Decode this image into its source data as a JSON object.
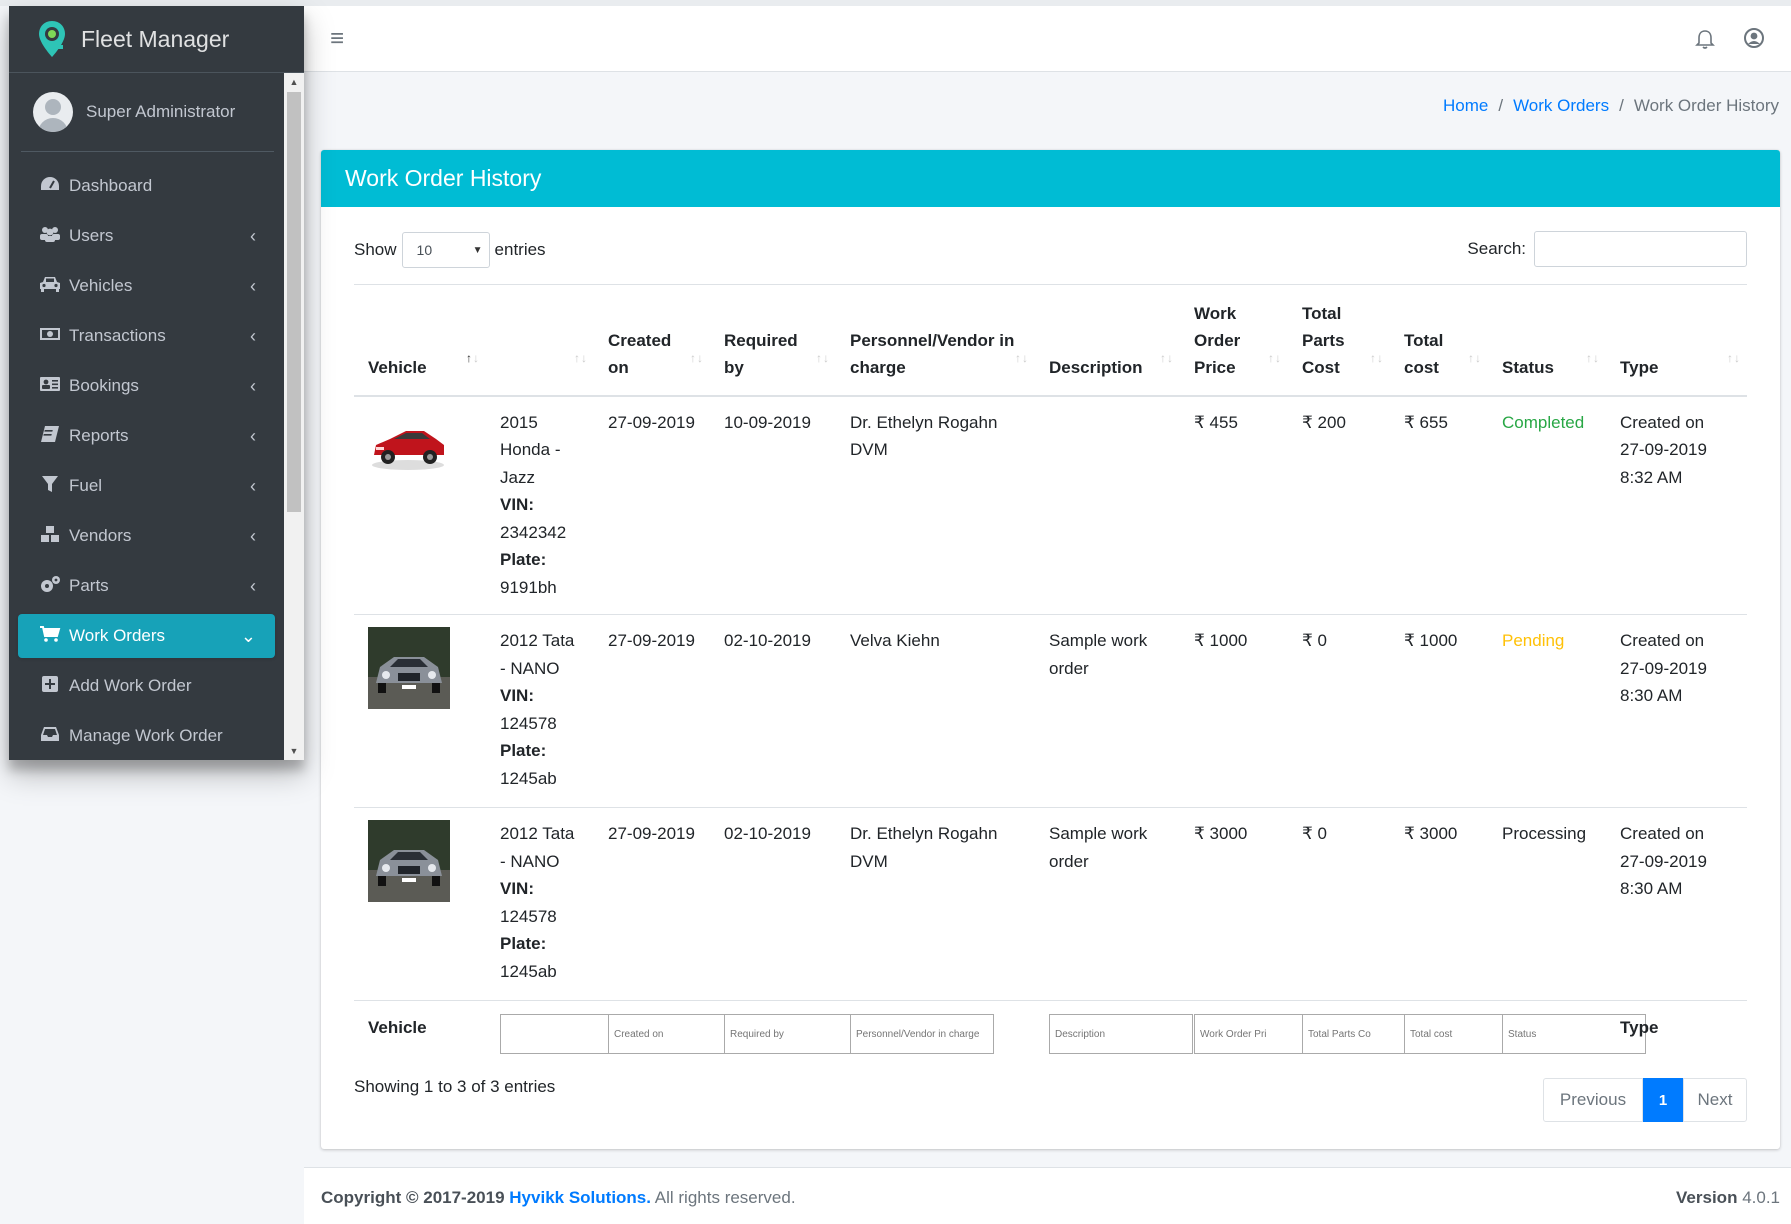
{
  "app": {
    "brand": "Fleet Manager",
    "user": "Super Administrator"
  },
  "sidebar": {
    "items": [
      {
        "label": "Dashboard",
        "icon": "dashboard-icon"
      },
      {
        "label": "Users",
        "icon": "users-icon"
      },
      {
        "label": "Vehicles",
        "icon": "car-icon"
      },
      {
        "label": "Transactions",
        "icon": "money-icon"
      },
      {
        "label": "Bookings",
        "icon": "address-card-icon"
      },
      {
        "label": "Reports",
        "icon": "book-icon"
      },
      {
        "label": "Fuel",
        "icon": "filter-icon"
      },
      {
        "label": "Vendors",
        "icon": "cubes-icon"
      },
      {
        "label": "Parts",
        "icon": "cogs-icon"
      },
      {
        "label": "Work Orders",
        "icon": "cart-icon"
      },
      {
        "label": "Add Work Order",
        "icon": "plus-square-icon"
      },
      {
        "label": "Manage Work Order",
        "icon": "inbox-icon"
      }
    ],
    "active_color": "#17a2b8"
  },
  "breadcrumb": {
    "home": "Home",
    "work_orders": "Work Orders",
    "current": "Work Order History"
  },
  "card": {
    "title": "Work Order History",
    "header_color": "#00bcd4"
  },
  "table_controls": {
    "show_label": "Show",
    "length_value": "10",
    "entries_label": "entries",
    "search_label": "Search:"
  },
  "table": {
    "headers": {
      "vehicle": "Vehicle",
      "created_on": "Created on",
      "required_by": "Required by",
      "personnel": "Personnel/Vendor in charge",
      "description": "Description",
      "work_order_price": "Work Order Price",
      "total_parts_cost": "Total Parts Cost",
      "total_cost": "Total cost",
      "status": "Status",
      "type": "Type"
    },
    "vin_label": "VIN:",
    "plate_label": "Plate:",
    "rows": [
      {
        "vehicle_name": "2015 Honda - Jazz",
        "vin": "2342342",
        "plate": "9191bh",
        "created_on": "27-09-2019",
        "required_by": "10-09-2019",
        "personnel": "Dr. Ethelyn Rogahn DVM",
        "description": "",
        "price": "₹ 455",
        "parts_cost": "₹ 200",
        "total_cost": "₹ 655",
        "status": "Completed",
        "type": "Created on 27-09-2019 8:32 AM"
      },
      {
        "vehicle_name": "2012 Tata - NANO",
        "vin": "124578",
        "plate": "1245ab",
        "created_on": "27-09-2019",
        "required_by": "02-10-2019",
        "personnel": "Velva Kiehn",
        "description": "Sample work order",
        "price": "₹ 1000",
        "parts_cost": "₹ 0",
        "total_cost": "₹ 1000",
        "status": "Pending",
        "type": "Created on 27-09-2019 8:30 AM"
      },
      {
        "vehicle_name": "2012 Tata - NANO",
        "vin": "124578",
        "plate": "1245ab",
        "created_on": "27-09-2019",
        "required_by": "02-10-2019",
        "personnel": "Dr. Ethelyn Rogahn DVM",
        "description": "Sample work order",
        "price": "₹ 3000",
        "parts_cost": "₹ 0",
        "total_cost": "₹ 3000",
        "status": "Processing",
        "type": "Created on 27-09-2019 8:30 AM"
      }
    ],
    "footer": {
      "vehicle": "Vehicle",
      "type": "Type",
      "placeholders": {
        "created_on": "Created on",
        "required_by": "Required by",
        "personnel": "Personnel/Vendor in charge",
        "description": "Description",
        "price": "Work Order Pri",
        "parts_cost": "Total Parts Co",
        "total_cost": "Total cost",
        "status": "Status"
      }
    }
  },
  "pagination": {
    "info": "Showing 1 to 3 of 3 entries",
    "previous": "Previous",
    "current_page": "1",
    "next": "Next"
  },
  "footer": {
    "copyright_prefix": "Copyright © 2017-2019",
    "company": "Hyvikk Solutions.",
    "rights": "All rights reserved.",
    "version_label": "Version",
    "version": "4.0.1"
  },
  "status_colors": {
    "completed": "#28a745",
    "pending": "#ffc107"
  }
}
